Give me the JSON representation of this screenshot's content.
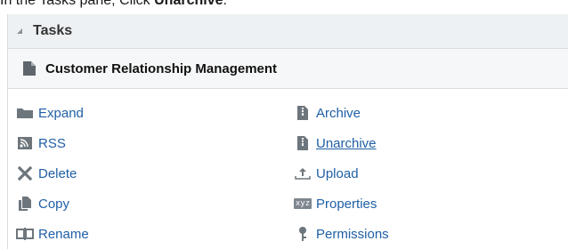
{
  "instruction": {
    "prefix": "In the Tasks pane, Click ",
    "action": "Unarchive",
    "suffix": "."
  },
  "pane": {
    "title": "Tasks",
    "group": {
      "title": "Customer Relationship Management",
      "icon": "document-icon"
    }
  },
  "tasks": {
    "left": [
      {
        "label": "Expand",
        "icon": "folder-icon"
      },
      {
        "label": "RSS",
        "icon": "rss-icon"
      },
      {
        "label": "Delete",
        "icon": "delete-x-icon"
      },
      {
        "label": "Copy",
        "icon": "copy-icon"
      },
      {
        "label": "Rename",
        "icon": "rename-icon"
      }
    ],
    "right": [
      {
        "label": "Archive",
        "icon": "archive-icon"
      },
      {
        "label": "Unarchive",
        "icon": "unarchive-icon"
      },
      {
        "label": "Upload",
        "icon": "upload-icon"
      },
      {
        "label": "Properties",
        "icon": "properties-xyz-icon",
        "icon_text": "xyz"
      },
      {
        "label": "Permissions",
        "icon": "permissions-icon"
      }
    ]
  },
  "colors": {
    "link": "#1f5fa6",
    "icon_gray": "#6d767d",
    "header_bg": "#eef1f3"
  }
}
